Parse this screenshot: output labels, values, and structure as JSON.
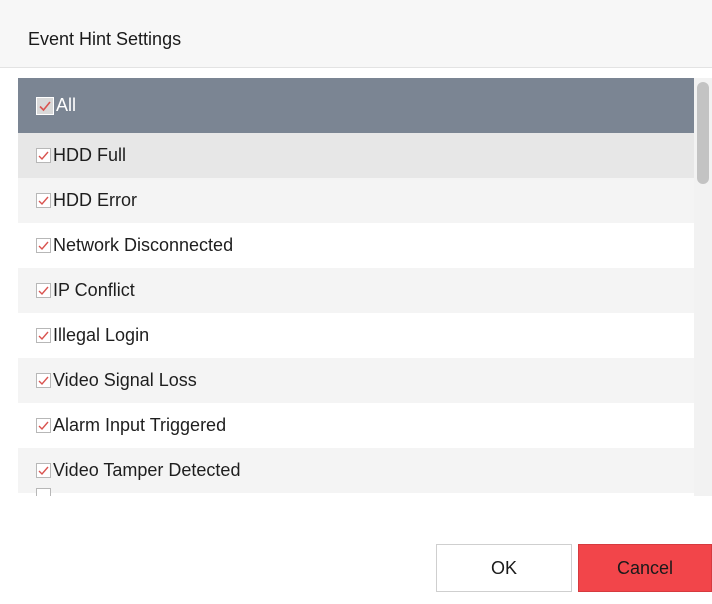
{
  "dialog": {
    "title": "Event Hint Settings"
  },
  "list": {
    "all_item": {
      "label": "All",
      "checked": true
    },
    "items": [
      {
        "label": "HDD Full",
        "checked": true
      },
      {
        "label": "HDD Error",
        "checked": true
      },
      {
        "label": "Network Disconnected",
        "checked": true
      },
      {
        "label": "IP Conflict",
        "checked": true
      },
      {
        "label": "Illegal Login",
        "checked": true
      },
      {
        "label": "Video Signal Loss",
        "checked": true
      },
      {
        "label": "Alarm Input Triggered",
        "checked": true
      },
      {
        "label": "Video Tamper Detected",
        "checked": true
      }
    ]
  },
  "buttons": {
    "ok_label": "OK",
    "cancel_label": "Cancel"
  },
  "colors": {
    "header_row": "#7b8593",
    "check_mark": "#d9534f",
    "cancel_button": "#f2454a"
  },
  "icons": {
    "checkbox": "checkbox-checked-icon"
  }
}
